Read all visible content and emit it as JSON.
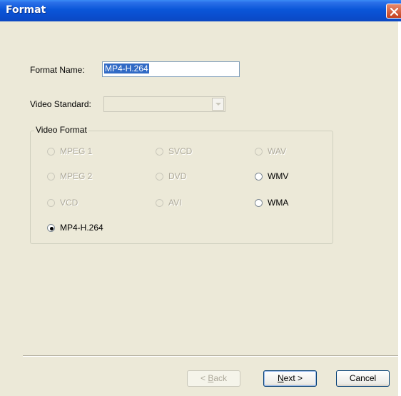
{
  "window": {
    "title": "Format"
  },
  "form": {
    "format_name_label": "Format Name:",
    "format_name_value": "MP4-H.264",
    "video_standard_label": "Video Standard:",
    "video_standard_value": ""
  },
  "group": {
    "title": "Video Format",
    "options": [
      {
        "label": "MPEG 1",
        "enabled": false,
        "checked": false
      },
      {
        "label": "SVCD",
        "enabled": false,
        "checked": false
      },
      {
        "label": "WAV",
        "enabled": false,
        "checked": false
      },
      {
        "label": "MPEG 2",
        "enabled": false,
        "checked": false
      },
      {
        "label": "DVD",
        "enabled": false,
        "checked": false
      },
      {
        "label": "WMV",
        "enabled": true,
        "checked": false
      },
      {
        "label": "VCD",
        "enabled": false,
        "checked": false
      },
      {
        "label": "AVI",
        "enabled": false,
        "checked": false
      },
      {
        "label": "WMA",
        "enabled": true,
        "checked": false
      },
      {
        "label": "MP4-H.264",
        "enabled": true,
        "checked": true
      }
    ]
  },
  "buttons": {
    "back_prefix": "< ",
    "back_mnemonic": "B",
    "back_rest": "ack",
    "back_enabled": false,
    "next_mnemonic": "N",
    "next_rest": "ext >",
    "cancel": "Cancel"
  },
  "icons": {
    "close": "close-icon",
    "dropdown": "chevron-down-icon"
  },
  "colors": {
    "titlebar": "#0A56D8",
    "close_button": "#D8532E",
    "selection": "#316AC5",
    "dialog_bg": "#ECE9D8"
  }
}
